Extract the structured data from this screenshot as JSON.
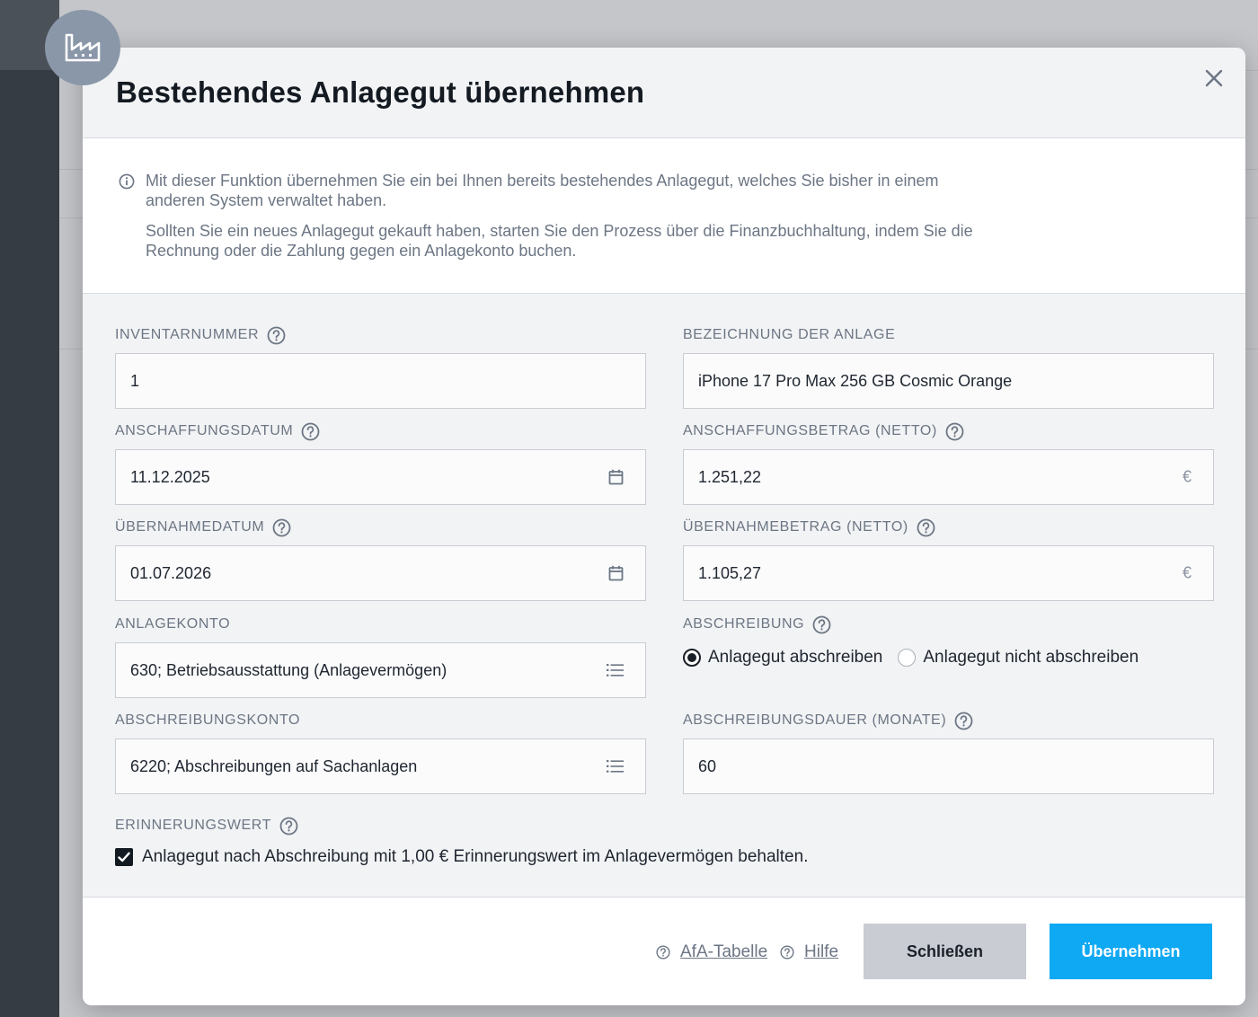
{
  "modal": {
    "title": "Bestehendes Anlagegut übernehmen",
    "close_icon": "close-icon",
    "avatar_icon": "factory-icon"
  },
  "info": {
    "paragraph_1": "Mit dieser Funktion übernehmen Sie ein bei Ihnen bereits bestehendes Anlagegut, welches Sie bisher in einem anderen System verwaltet haben.",
    "paragraph_2": "Sollten Sie ein neues Anlagegut gekauft haben, starten Sie den Prozess über die Finanzbuchhaltung, indem Sie die Rechnung oder die Zahlung gegen ein Anlagekonto buchen."
  },
  "form": {
    "inventarnummer": {
      "label": "INVENTARNUMMER",
      "value": "1"
    },
    "bezeichnung": {
      "label": "BEZEICHNUNG DER ANLAGE",
      "value": "iPhone 17 Pro Max 256 GB Cosmic Orange"
    },
    "anschaffungsdatum": {
      "label": "ANSCHAFFUNGSDATUM",
      "value": "11.12.2025"
    },
    "anschaffungsbetrag": {
      "label": "ANSCHAFFUNGSBETRAG (NETTO)",
      "value": "1.251,22",
      "currency": "€"
    },
    "uebernahmedatum": {
      "label": "ÜBERNAHMEDATUM",
      "value": "01.07.2026"
    },
    "uebernahmebetrag": {
      "label": "ÜBERNAHMEBETRAG (NETTO)",
      "value": "1.105,27",
      "currency": "€"
    },
    "anlagekonto": {
      "label": "ANLAGEKONTO",
      "value": "630; Betriebsausstattung (Anlagevermögen)"
    },
    "abschreibung": {
      "label": "ABSCHREIBUNG",
      "options": [
        "Anlagegut abschreiben",
        "Anlagegut nicht abschreiben"
      ],
      "selected": 0
    },
    "abschreibungskonto": {
      "label": "ABSCHREIBUNGSKONTO",
      "value": "6220; Abschreibungen auf Sachanlagen"
    },
    "abschreibungsdauer": {
      "label": "ABSCHREIBUNGSDAUER (MONATE)",
      "value": "60"
    },
    "erinnerungswert": {
      "label": "ERINNERUNGSWERT",
      "checkbox_label": "Anlagegut nach Abschreibung mit 1,00 € Erinnerungswert im Anlagevermögen behalten.",
      "checked": true
    }
  },
  "footer": {
    "afa_link": "AfA-Tabelle",
    "help_link": "Hilfe",
    "close_button": "Schließen",
    "apply_button": "Übernehmen"
  },
  "colors": {
    "primary": "#0fa8f3",
    "secondary_button": "#c9ccd3",
    "label_gray": "#6c7684"
  }
}
